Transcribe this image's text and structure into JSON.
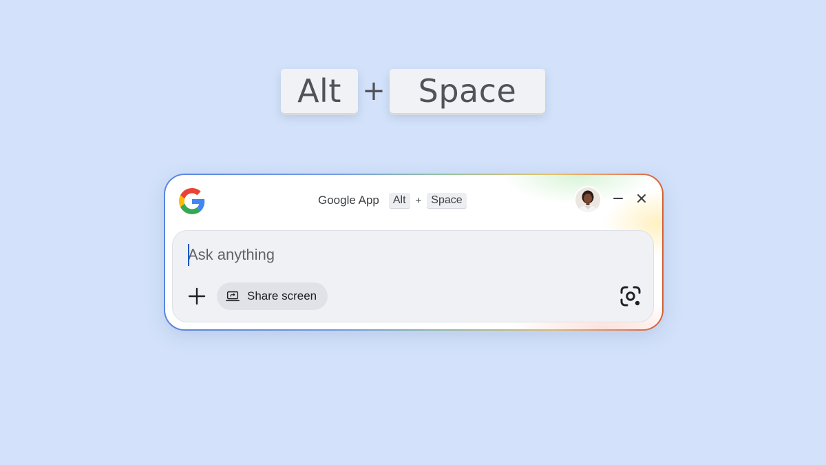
{
  "shortcut": {
    "key1": "Alt",
    "plus": "+",
    "key2": "Space"
  },
  "window": {
    "title": "Google App",
    "shortcut_key1": "Alt",
    "shortcut_plus": "+",
    "shortcut_key2": "Space",
    "logo_icon": "google-g-icon",
    "avatar_icon": "user-avatar",
    "minimize_icon": "minimize-icon",
    "close_icon": "close-icon"
  },
  "input": {
    "placeholder": "Ask anything",
    "value": ""
  },
  "actions": {
    "add_icon": "plus-icon",
    "share_label": "Share screen",
    "share_icon": "share-screen-icon",
    "lens_icon": "google-lens-icon"
  },
  "colors": {
    "background": "#d3e2fa",
    "google_blue": "#4285F4",
    "google_red": "#EA4335",
    "google_yellow": "#FBBC05",
    "google_green": "#34A853",
    "caret": "#1a56c4"
  }
}
